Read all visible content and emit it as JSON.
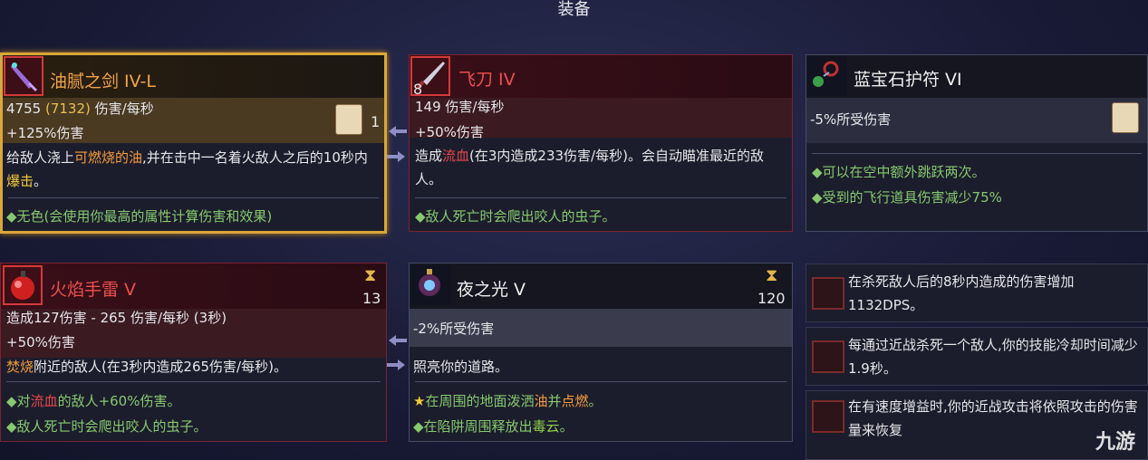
{
  "title": "装备",
  "cards": {
    "sword": {
      "name": "油腻之剑 IV-L",
      "dps_main": "4755",
      "dps_paren": "(7132)",
      "dps_unit": "伤害/每秒",
      "bonus": "+125%伤害",
      "scroll_count": "1",
      "desc_1": "给敌人浇上",
      "desc_k1": "可燃烧的油",
      "desc_2": ",并在击中一名着火敌人之后的10秒内",
      "desc_k2": "爆击",
      "desc_3": "。",
      "perk": "◆无色(会使用你最高的属性计算伤害和效果)"
    },
    "knife": {
      "name": "飞刀 IV",
      "ammo": "8",
      "dps": "149 伤害/每秒",
      "bonus": "+50%伤害",
      "desc_1": "造成",
      "desc_k1": "流血",
      "desc_2": "(在3内造成233伤害/每秒)。会自动瞄准最近的敌人。",
      "perk": "◆敌人死亡时会爬出咬人的虫子。"
    },
    "amulet": {
      "name": "蓝宝石护符 VI",
      "stat": "-5%所受伤害",
      "perk1": "◆可以在空中额外跳跃两次。",
      "perk2": "◆受到的飞行道具伤害减少75%"
    },
    "grenade": {
      "name": "火焰手雷 V",
      "cooldown": "13",
      "dmg": "造成127伤害 - 265 伤害/每秒 (3秒)",
      "bonus": "+50%伤害",
      "desc_k1": "焚烧",
      "desc_2": "附近的敌人(在3秒内造成265伤害/每秒)。",
      "perk1_a": "◆对",
      "perk1_k": "流血",
      "perk1_b": "的敌人+60%伤害。",
      "perk2": "◆敌人死亡时会爬出咬人的虫子。"
    },
    "nightlight": {
      "name": "夜之光 V",
      "cooldown": "120",
      "stat": "-2%所受伤害",
      "desc": "照亮你的道路。",
      "perk1_star": "★",
      "perk1_a": "在周围的地面泼洒",
      "perk1_k": "油",
      "perk1_b": "并",
      "perk1_k2": "点燃",
      "perk1_c": "。",
      "perk2_a": "◆在陷阱周围释放出",
      "perk2_k": "毒云",
      "perk2_b": "。"
    }
  },
  "mutations": [
    {
      "text": "在杀死敌人后的8秒内造成的伤害增加1132DPS。"
    },
    {
      "text": "每通过近战杀死一个敌人,你的技能冷却时间减少1.9秒。"
    },
    {
      "text": "在有速度增益时,你的近战攻击将依照攻击的伤害量来恢复"
    }
  ],
  "watermark": "九游"
}
